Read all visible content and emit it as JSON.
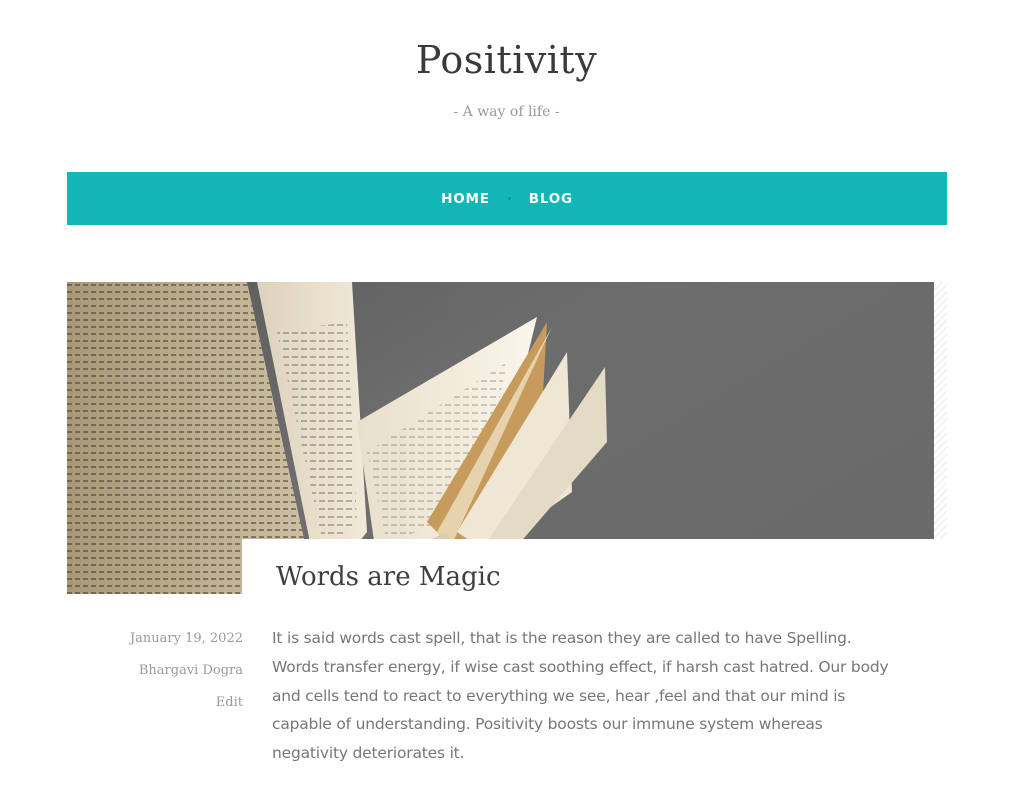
{
  "site": {
    "title": "Positivity",
    "tagline": "- A way of life -"
  },
  "nav": {
    "items": [
      {
        "label": "HOME"
      },
      {
        "label": "BLOG"
      }
    ],
    "color": "#13b6b7"
  },
  "post": {
    "title": "Words are Magic",
    "date": "January 19, 2022",
    "author": "Bhargavi Dogra",
    "edit_label": "Edit",
    "excerpt": "It is said words cast spell, that is the reason they are called to have Spelling. Words transfer energy, if wise cast soothing effect, if harsh cast hatred. Our body and cells tend to react to everything we see, hear ,feel and that our mind is capable of understanding. Positivity boosts our immune system whereas negativity deteriorates it.",
    "image_subject": "open book with fanned pages"
  }
}
